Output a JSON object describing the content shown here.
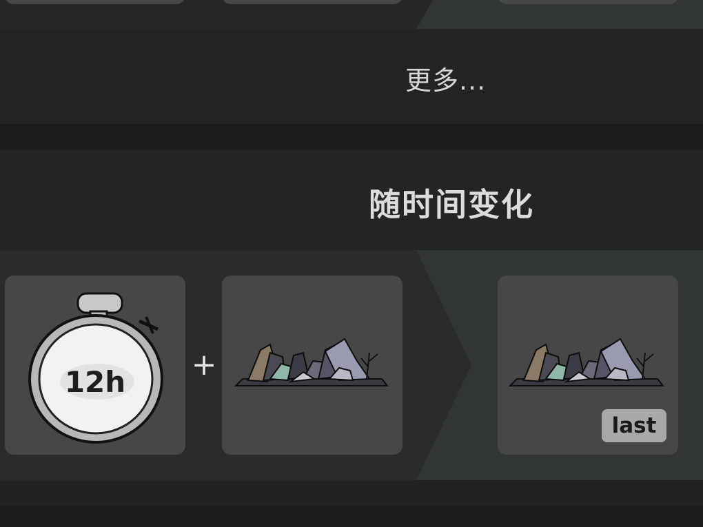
{
  "more_section": {
    "label": "更多..."
  },
  "title_section": {
    "label": "随时间变化"
  },
  "recipe": {
    "timer": {
      "label": "12h",
      "icon": "stopwatch-icon"
    },
    "operator": "+",
    "ingredient": {
      "icon": "rubble-pile-icon"
    },
    "result": {
      "icon": "rubble-pile-icon",
      "badge": "last"
    }
  },
  "colors": {
    "background": "#1b1b1b",
    "row": "#2b2b2b",
    "slot": "#474747",
    "arrow": "#323632",
    "text": "#dcdcdc"
  }
}
